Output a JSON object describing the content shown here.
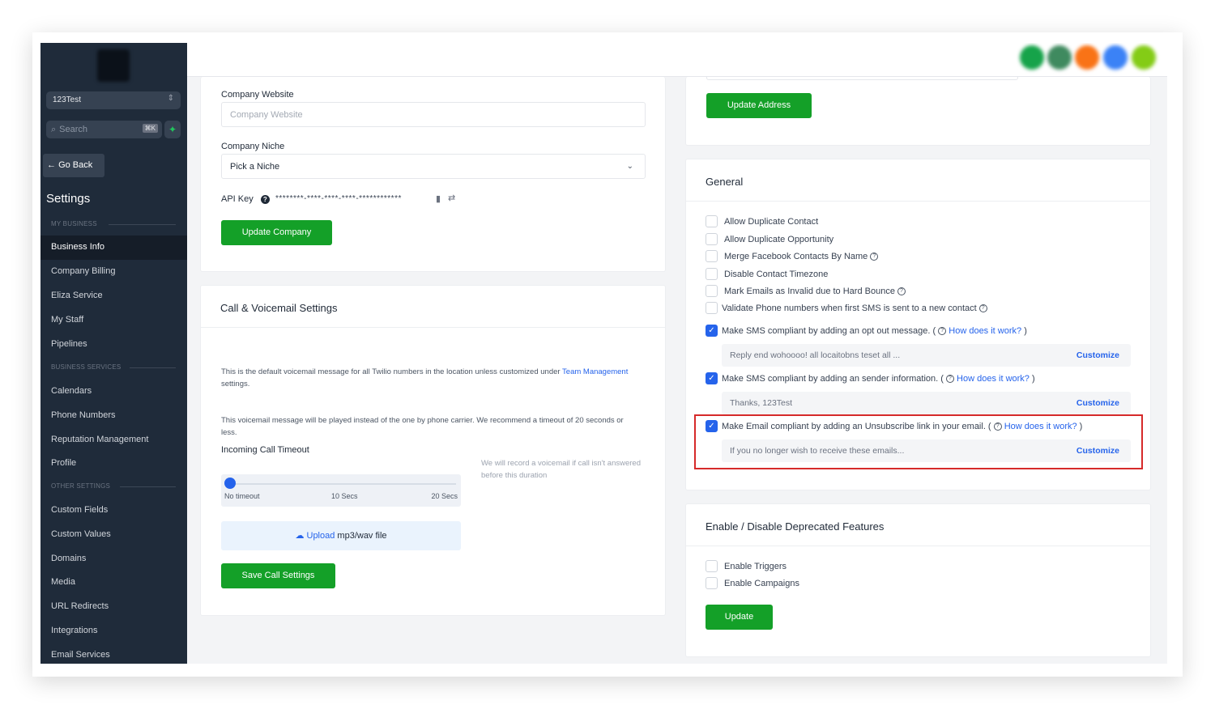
{
  "sidebar": {
    "location": "123Test",
    "search_placeholder": "Search",
    "search_shortcut": "⌘K",
    "go_back": "Go Back",
    "title": "Settings",
    "sections": {
      "my_business": "MY BUSINESS",
      "business_services": "BUSINESS SERVICES",
      "other_settings": "OTHER SETTINGS"
    },
    "items": [
      "Business Info",
      "Company Billing",
      "Eliza Service",
      "My Staff",
      "Pipelines",
      "Calendars",
      "Phone Numbers",
      "Reputation Management",
      "Profile",
      "Custom Fields",
      "Custom Values",
      "Domains",
      "Media",
      "URL Redirects",
      "Integrations",
      "Email Services"
    ],
    "active_item": "Business Info"
  },
  "company": {
    "website_label": "Company Website",
    "website_placeholder": "Company Website",
    "niche_label": "Company Niche",
    "niche_value": "Pick a Niche",
    "api_key_label": "API Key",
    "api_key_value": "********-****-****-****-************",
    "update_button": "Update Company"
  },
  "call": {
    "title": "Call & Voicemail Settings",
    "desc1_prefix": "This is the default voicemail message for all Twilio numbers in the location unless customized under ",
    "desc1_link": "Team Management",
    "desc1_suffix": " settings.",
    "desc2": "This voicemail message will be played instead of the one by phone carrier. We recommend a timeout of 20 seconds or less.",
    "timeout_label": "Incoming Call Timeout",
    "slider_labels": [
      "No timeout",
      "10 Secs",
      "20 Secs"
    ],
    "slider_value": 0,
    "note": "We will record a voicemail if call isn't answered before this duration",
    "upload_link": "Upload",
    "upload_rest": " mp3/wav file",
    "save_button": "Save Call Settings"
  },
  "address": {
    "update_button": "Update Address"
  },
  "general": {
    "title": "General",
    "options": [
      {
        "label": "Allow Duplicate Contact",
        "checked": false,
        "help": false
      },
      {
        "label": "Allow Duplicate Opportunity",
        "checked": false,
        "help": false
      },
      {
        "label": "Merge Facebook Contacts By Name",
        "checked": false,
        "help": true
      },
      {
        "label": "Disable Contact Timezone",
        "checked": false,
        "help": false
      },
      {
        "label": "Mark Emails as Invalid due to Hard Bounce",
        "checked": false,
        "help": true
      },
      {
        "label": "Validate Phone numbers when first SMS is sent to a new contact",
        "checked": false,
        "help": true
      }
    ],
    "compliance": [
      {
        "label": "Make SMS compliant by adding an opt out message. (",
        "link": "How does it work?",
        "close": " )",
        "value": "Reply  end wohoooo! all locaitobns teset all ...",
        "customize": "Customize",
        "checked": true
      },
      {
        "label": "Make SMS compliant by adding an sender information. (",
        "link": "How does it work?",
        "close": " )",
        "value": "Thanks, 123Test",
        "customize": "Customize",
        "checked": true
      },
      {
        "label": "Make Email compliant by adding an Unsubscribe link in your email. (",
        "link": "How does it work?",
        "close": " )",
        "value": "If you no longer wish to receive these emails...",
        "customize": "Customize",
        "checked": true
      }
    ]
  },
  "deprecated": {
    "title": "Enable / Disable Deprecated Features",
    "options": [
      {
        "label": "Enable Triggers",
        "checked": false
      },
      {
        "label": "Enable Campaigns",
        "checked": false
      }
    ],
    "update_button": "Update"
  },
  "colors": {
    "sidebar_bg": "#1f2b3a",
    "primary_green": "#14a028",
    "link_blue": "#2563eb",
    "highlight_red": "#d62a2a"
  }
}
